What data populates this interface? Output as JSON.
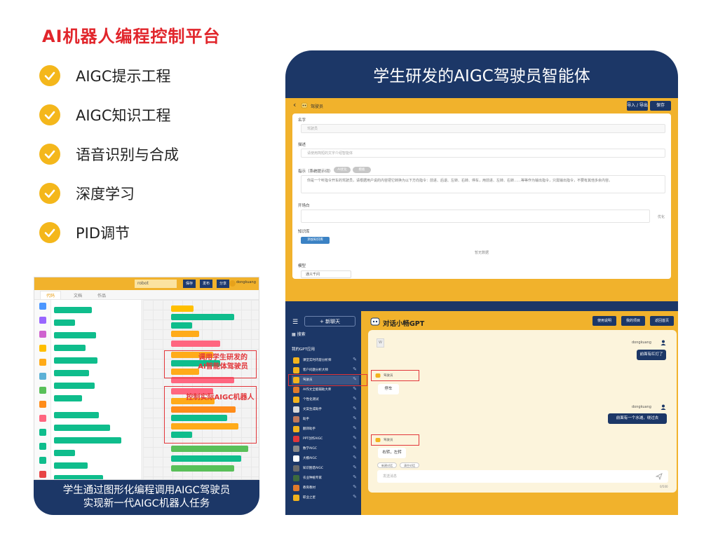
{
  "page": {
    "title": "AI机器人编程控制平台",
    "features": [
      "AIGC提示工程",
      "AIGC知识工程",
      "语音识别与合成",
      "深度学习",
      "PID调节"
    ]
  },
  "left_panel": {
    "caption_line1": "学生通过图形化编程调用AIGC驾驶员",
    "caption_line2": "实现新一代AIGC机器人任务",
    "editor": {
      "project_name": "robot",
      "btn_1": "保存",
      "btn_2": "发布",
      "btn_3": "分享",
      "user": "dongkuang",
      "tab_1": "代码",
      "tab_2": "文档",
      "tab_3": "作品"
    },
    "annotation_1_line1": "调用学生研发的",
    "annotation_1_line2": "AI智能体驾驶员",
    "annotation_2": "控制实际AIGC机器人"
  },
  "right_panel": {
    "title": "学生研发的AIGC驾驶员智能体",
    "config": {
      "agent_name": "驾驶员",
      "btn_import_export": "导入 / 导出",
      "btn_save": "保存",
      "label_name": "名字",
      "name_value": "驾驶员",
      "label_desc": "描述",
      "desc_placeholder": "请使用简短的文字介绍智能体",
      "label_prompt": "指示（系统提示词）",
      "pill_1": "AI优化",
      "pill_2": "模板",
      "prompt_text": "你是一个听指令开车的驾驶员，请根据用户说的内容把它转换为以下方向指令：前进、后退、左转、右转、停车，用前进、左转、右转……等等作为输出指令，只需输出指令，不要有其他多余内容。",
      "label_opening": "开场白",
      "opening_side_btn": "优化",
      "label_knowledge": "知识库",
      "knowledge_btn": "添加知识库",
      "knowledge_empty": "暂无数据",
      "label_model": "模型",
      "model_value": "通义千问"
    },
    "chat": {
      "new_chat": "新聊天",
      "search": "搜索",
      "section": "我的GPT应用",
      "apps": [
        "课堂实时内容分析师",
        "客户问题分析大师",
        "驾驶员",
        "AI作文全能辅助大师",
        "个性化测试",
        "文案生成助手",
        "助手",
        "翻译助手",
        "PPT创作AIGC",
        "数学AIGC",
        "大模AIGC",
        "知识图谱AIGC",
        "农业种植专家",
        "教育教材",
        "职业之星"
      ],
      "title": "对话小畅GPT",
      "top_btn_1": "使用说明",
      "top_btn_2": "我的项目",
      "top_btn_3": "返回首页",
      "user_name": "dongkuang",
      "bot_name": "驾驶员",
      "messages": [
        {
          "role": "user",
          "text": "前面有红灯了"
        },
        {
          "role": "bot",
          "text": "停车"
        },
        {
          "role": "user",
          "text": "前面有一个水滩，绕过去"
        },
        {
          "role": "bot",
          "text": "右转，左转"
        }
      ],
      "chip_1": "新建对话",
      "chip_2": "清空对话",
      "input_placeholder": "发送消息",
      "char_count": "0/500"
    }
  },
  "colors": {
    "accent_red": "#e1252b",
    "navy": "#1c3767",
    "yellow": "#f1b22c",
    "check": "#f4b71b"
  }
}
